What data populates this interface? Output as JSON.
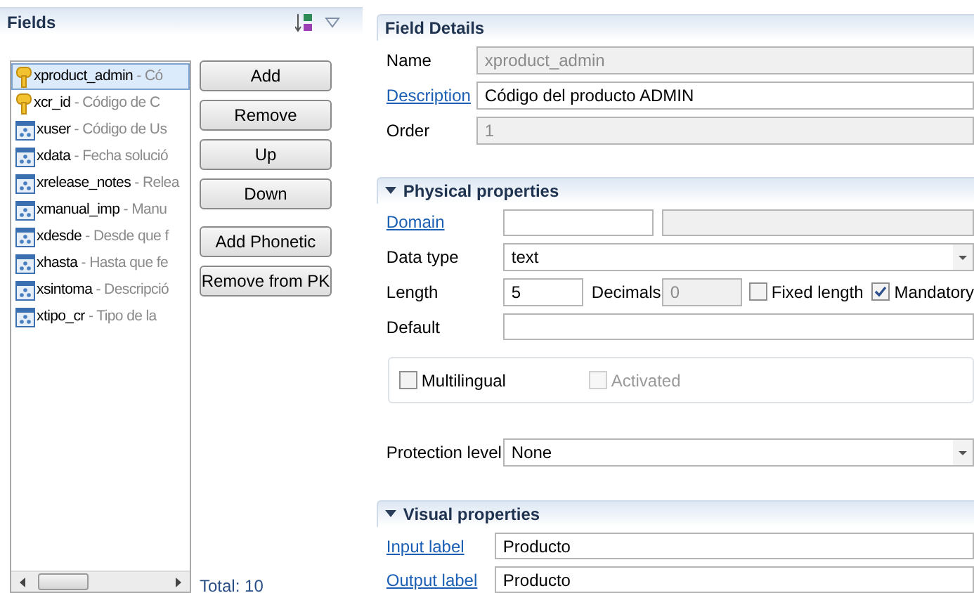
{
  "fields_panel": {
    "title": "Fields",
    "items": [
      {
        "name": "xproduct_admin",
        "description": " - Có",
        "kind": "key",
        "selected": true
      },
      {
        "name": "xcr_id",
        "description": " - Código de C",
        "kind": "key",
        "selected": false
      },
      {
        "name": "xuser",
        "description": " - Código de Us",
        "kind": "field",
        "selected": false
      },
      {
        "name": "xdata",
        "description": " - Fecha solució",
        "kind": "field",
        "selected": false
      },
      {
        "name": "xrelease_notes",
        "description": " - Relea",
        "kind": "field",
        "selected": false
      },
      {
        "name": "xmanual_imp",
        "description": " - Manu",
        "kind": "field",
        "selected": false
      },
      {
        "name": "xdesde",
        "description": " - Desde que f",
        "kind": "field",
        "selected": false
      },
      {
        "name": "xhasta",
        "description": " - Hasta que fe",
        "kind": "field",
        "selected": false
      },
      {
        "name": "xsintoma",
        "description": " - Descripció",
        "kind": "field",
        "selected": false
      },
      {
        "name": "xtipo_cr",
        "description": " - Tipo de la",
        "kind": "field",
        "selected": false
      }
    ],
    "buttons": [
      "Add",
      "Remove",
      "Up",
      "Down"
    ],
    "extra_buttons": [
      "Add Phonetic",
      "Remove from PK"
    ],
    "total": "Total: 10"
  },
  "field_details": {
    "title": "Field Details",
    "rows": [
      {
        "label": "Name",
        "link": false,
        "value": "xproduct_admin",
        "disabled": true
      },
      {
        "label": "Description",
        "link": true,
        "value": "Código del producto ADMIN",
        "disabled": false
      },
      {
        "label": "Order",
        "link": false,
        "value": "1",
        "disabled": true
      }
    ]
  },
  "physical_properties": {
    "title": "Physical properties",
    "expanded": true,
    "domain": {
      "label": "Domain",
      "link": true
    },
    "data_type": {
      "label": "Data type",
      "value": "text"
    },
    "length": {
      "label": "Length",
      "value": "5"
    },
    "decimals": {
      "label": "Decimals",
      "value": "0",
      "disabled": true
    },
    "options": [
      {
        "label": "Fixed length",
        "checked": false
      },
      {
        "label": "Mandatory",
        "checked": true
      }
    ],
    "default": {
      "label": "Default"
    },
    "group_options": [
      {
        "label": "Multilingual",
        "checked": false,
        "disabled": false
      },
      {
        "label": "Activated",
        "checked": false,
        "disabled": true
      }
    ],
    "protection_level": {
      "label": "Protection level",
      "value": "None"
    }
  },
  "visual_properties": {
    "title": "Visual properties",
    "expanded": true,
    "rows": [
      {
        "label": "Input label",
        "link": true,
        "value": "Producto"
      },
      {
        "label": "Output label",
        "link": true,
        "value": "Producto"
      }
    ]
  }
}
